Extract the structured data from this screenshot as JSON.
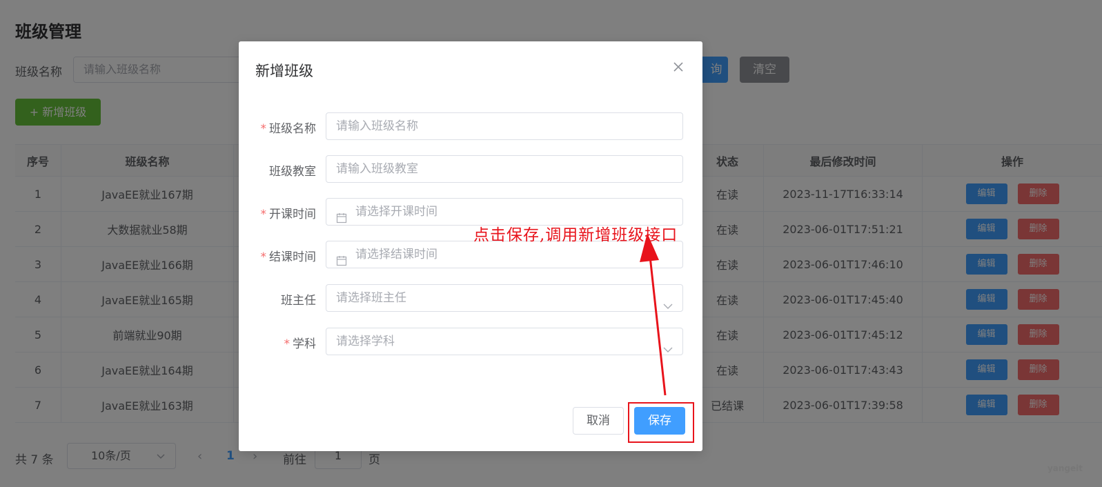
{
  "page": {
    "title": "班级管理",
    "search": {
      "label": "班级名称",
      "placeholder": "请输入班级名称"
    },
    "query_label": "询",
    "clear_label": "清空",
    "add_label": "+ 新增班级"
  },
  "table": {
    "headers": {
      "index": "序号",
      "name": "班级名称",
      "status": "状态",
      "time": "最后修改时间",
      "ops": "操作"
    },
    "rows": [
      {
        "index": "1",
        "name": "JavaEE就业167期",
        "status": "在读",
        "time": "2023-11-17T16:33:14"
      },
      {
        "index": "2",
        "name": "大数据就业58期",
        "status": "在读",
        "time": "2023-06-01T17:51:21"
      },
      {
        "index": "3",
        "name": "JavaEE就业166期",
        "status": "在读",
        "time": "2023-06-01T17:46:10"
      },
      {
        "index": "4",
        "name": "JavaEE就业165期",
        "status": "在读",
        "time": "2023-06-01T17:45:40"
      },
      {
        "index": "5",
        "name": "前端就业90期",
        "status": "在读",
        "time": "2023-06-01T17:45:12"
      },
      {
        "index": "6",
        "name": "JavaEE就业164期",
        "status": "在读",
        "time": "2023-06-01T17:43:43"
      },
      {
        "index": "7",
        "name": "JavaEE就业163期",
        "status": "已结课",
        "time": "2023-06-01T17:39:58"
      }
    ],
    "edit_label": "编辑",
    "delete_label": "删除"
  },
  "pager": {
    "total": "共 7 条",
    "page_size": "10条/页",
    "prev": "‹",
    "current": "1",
    "next": "›",
    "goto_label": "前往",
    "goto_value": "1",
    "unit": "页"
  },
  "watermark": "yangeit",
  "dialog": {
    "title": "新增班级",
    "fields": {
      "name": {
        "label": "班级名称",
        "placeholder": "请输入班级名称",
        "required": "*"
      },
      "room": {
        "label": "班级教室",
        "placeholder": "请输入班级教室"
      },
      "start": {
        "label": "开课时间",
        "placeholder": "请选择开课时间",
        "required": "*"
      },
      "end": {
        "label": "结课时间",
        "placeholder": "请选择结课时间",
        "required": "*"
      },
      "master": {
        "label": "班主任",
        "placeholder": "请选择班主任"
      },
      "subject": {
        "label": "学科",
        "placeholder": "请选择学科",
        "required": "*"
      }
    },
    "cancel_label": "取消",
    "save_label": "保存"
  },
  "annotation": {
    "text": "点击保存,调用新增班级接口"
  },
  "colors": {
    "primary": "#409eff",
    "success": "#67c23a",
    "danger": "#f56c6c",
    "info": "#909399",
    "annotation": "#e8131b"
  }
}
